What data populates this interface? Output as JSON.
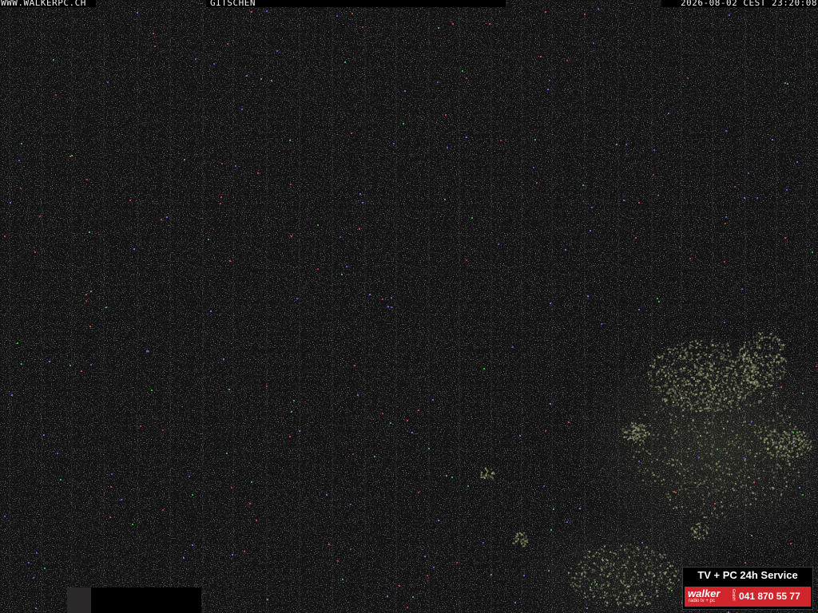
{
  "overlay": {
    "site": "WWW.WALKERPC.CH",
    "location": "GITSCHEN",
    "timestamp": "2026-08-02 CEST 23:20:08"
  },
  "ad": {
    "service": "TV + PC 24h Service",
    "brand": "walker",
    "brand_sub": "radio tv + pc",
    "brand_suffix": "GmbH",
    "phone": "041 870 55 77",
    "colors": {
      "banner_red": "#d1252c",
      "banner_black": "#000000"
    }
  },
  "scene": {
    "description_colors": {
      "sky": "#111112",
      "foliage": "#5e6448"
    }
  }
}
